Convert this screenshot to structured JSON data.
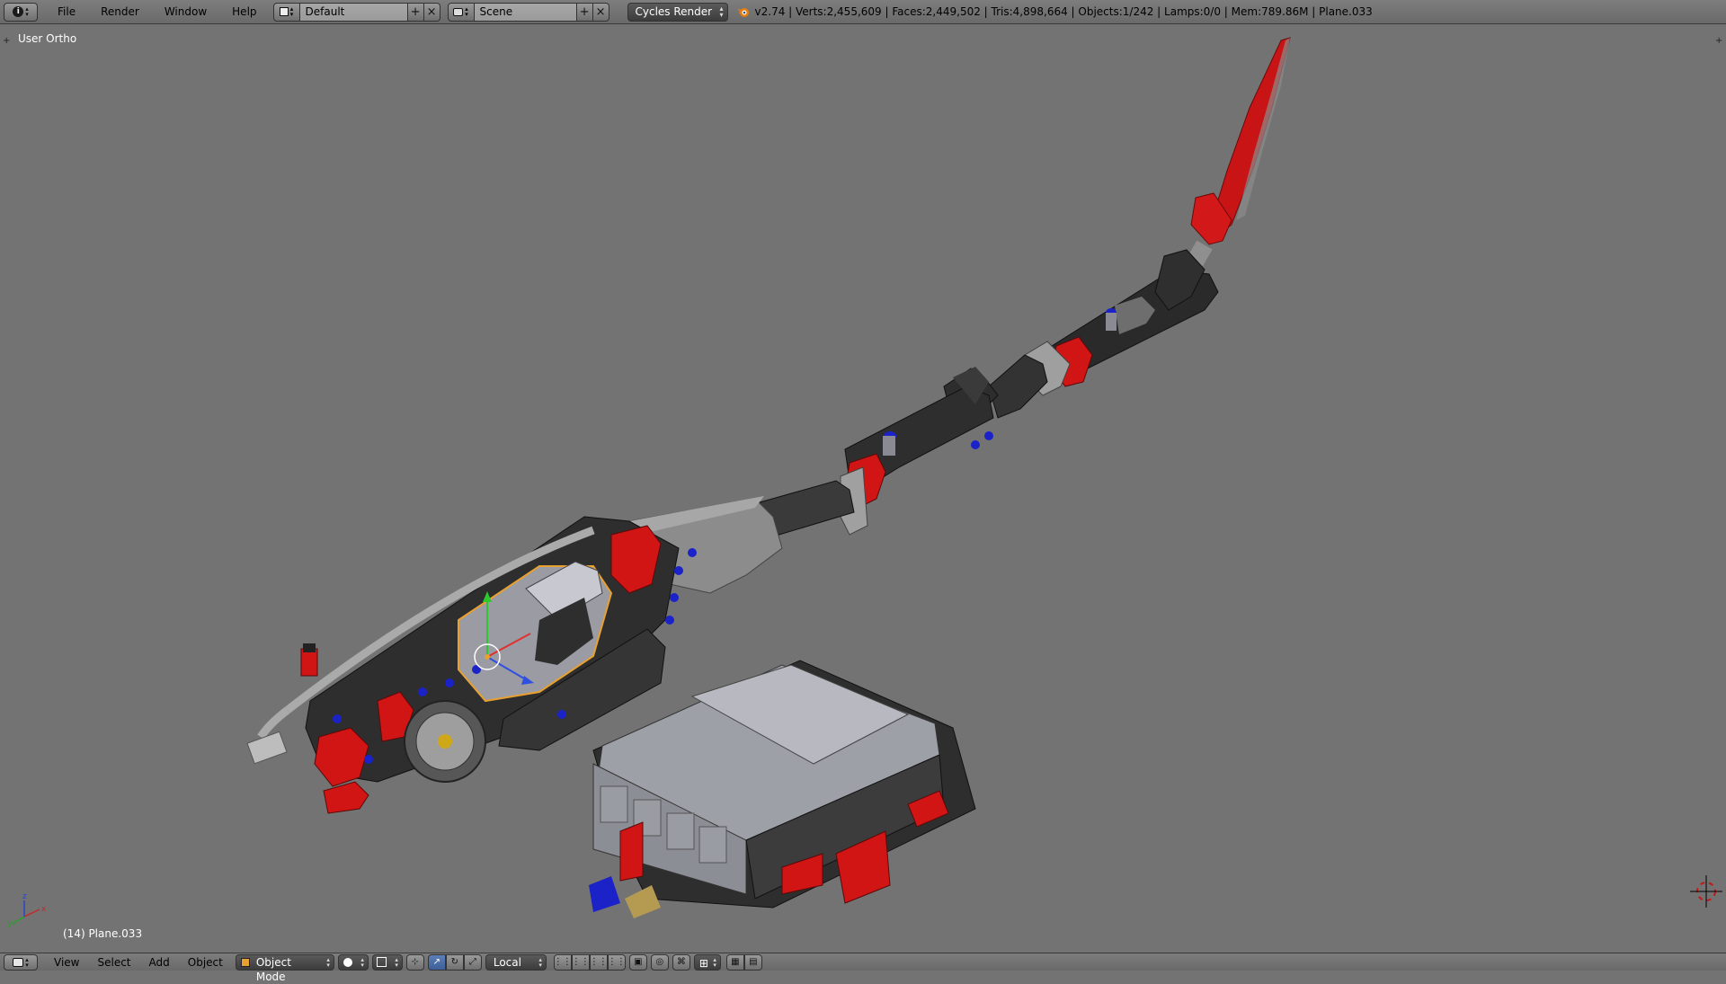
{
  "top_header": {
    "editor_type_icon": "info-icon",
    "menus": [
      "File",
      "Render",
      "Window",
      "Help"
    ],
    "layout": {
      "icon": "screen-layout-icon",
      "value": "Default"
    },
    "scene": {
      "icon": "scene-icon",
      "value": "Scene"
    },
    "render_engine": "Cycles Render",
    "blender_logo_icon": "blender-logo-icon",
    "stats": "v2.74 | Verts:2,455,609 | Faces:2,449,502 | Tris:4,898,664 | Objects:1/242 | Lamps:0/0 | Mem:789.86M | Plane.033"
  },
  "viewport": {
    "view_label": "User Ortho",
    "object_label": "(14) Plane.033",
    "axes": {
      "x": "x",
      "y": "y",
      "z": "z"
    },
    "colors": {
      "background": "#737373",
      "red": "#d11414",
      "dark": "#2e2e2e",
      "grey": "#9b9ba3",
      "blue": "#1a22c8",
      "selection": "#e8a030"
    }
  },
  "bottom_header": {
    "editor_type_icon": "3d-view-icon",
    "menus": [
      "View",
      "Select",
      "Add",
      "Object"
    ],
    "mode": "Object Mode",
    "shading_icon": "solid-shading-icon",
    "pivot_icon": "pivot-point-icon",
    "transform_orientation": "Local",
    "icons": [
      "manipulator-icon",
      "translate-icon",
      "rotate-icon",
      "scale-icon",
      "layers-icon",
      "proportional-edit-icon",
      "snap-icon",
      "render-icon",
      "opengl-render-icon"
    ]
  }
}
